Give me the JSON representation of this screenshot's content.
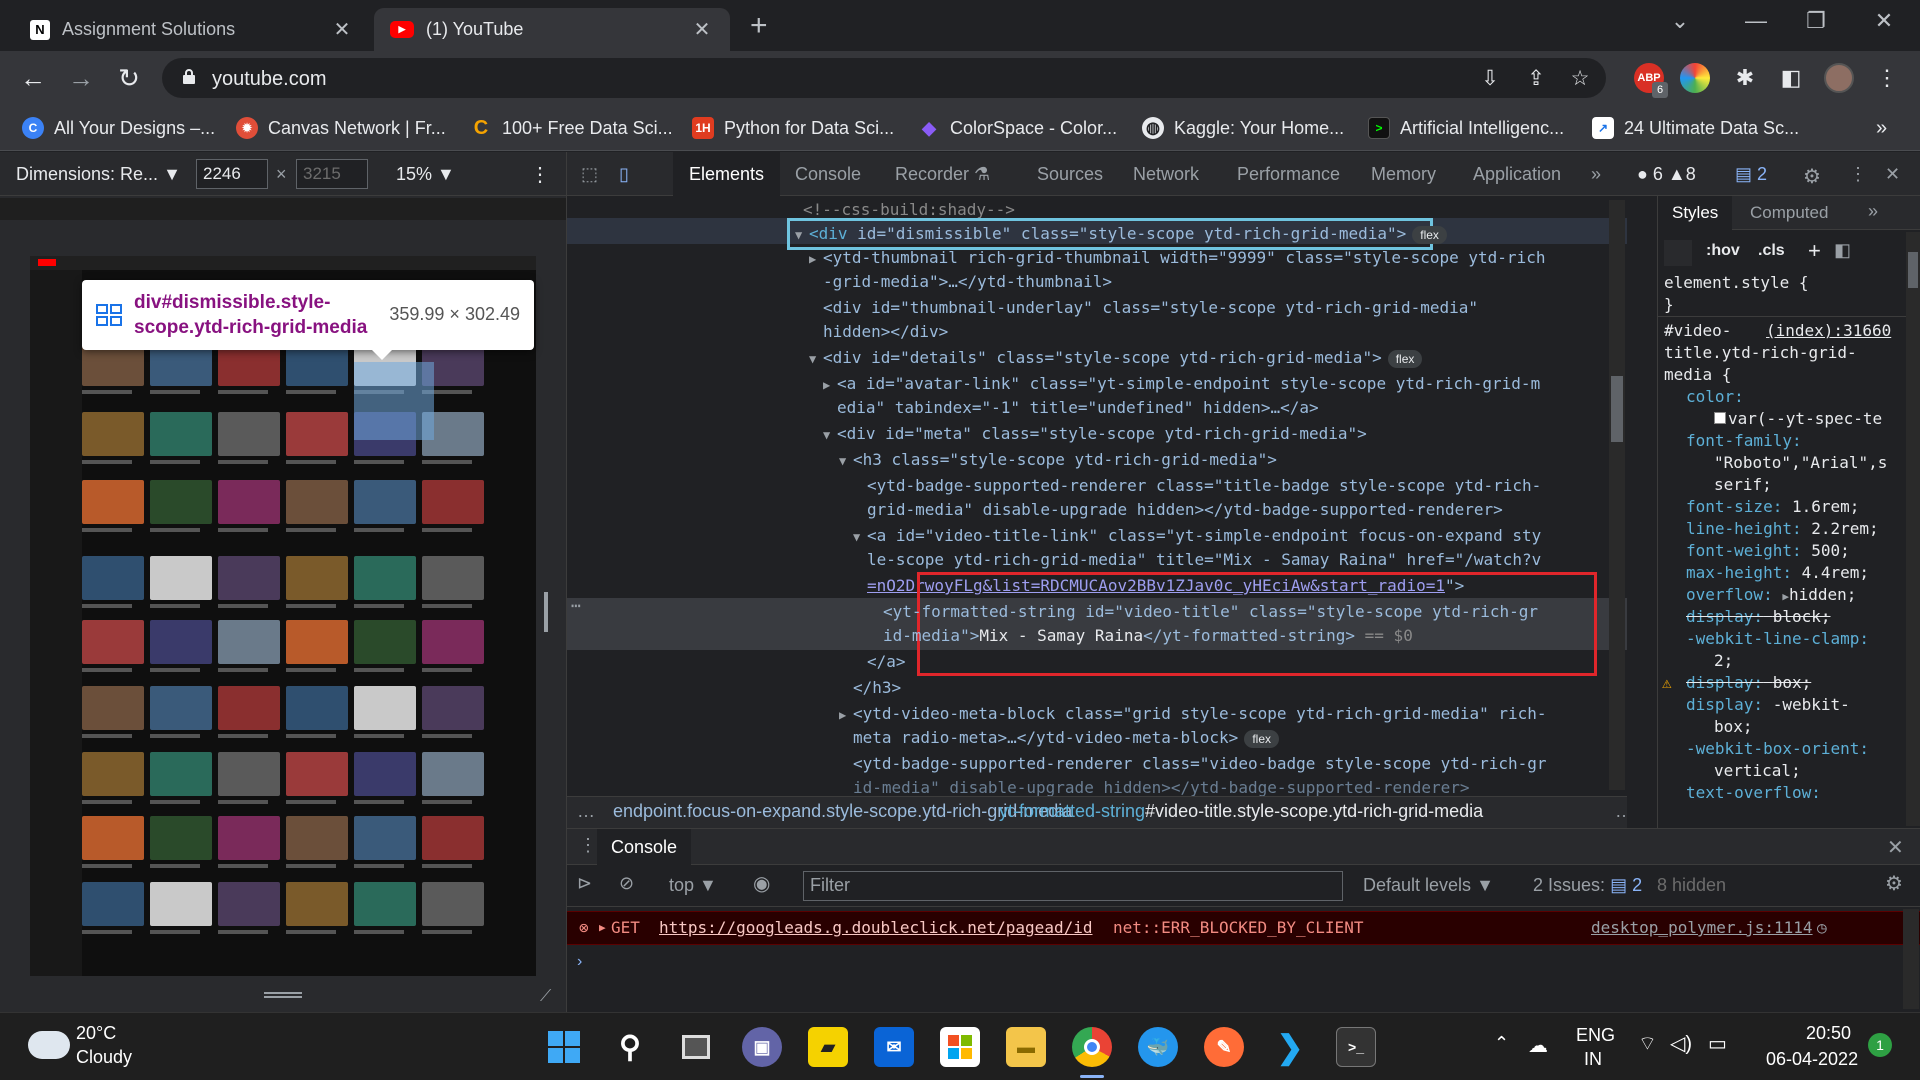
{
  "browser": {
    "tabs": [
      {
        "title": "Assignment Solutions",
        "favicon": "N"
      },
      {
        "title": "(1) YouTube",
        "favicon": "▶"
      }
    ],
    "url": "youtube.com",
    "ext_badge": "6",
    "bookmarks": [
      {
        "label": "All Your Designs –...",
        "color": "#3b82f6",
        "glyph": "C"
      },
      {
        "label": "Canvas Network | Fr...",
        "color": "#e04e39",
        "glyph": "✹"
      },
      {
        "label": "100+ Free Data Sci...",
        "color": "#f5a300",
        "glyph": "C"
      },
      {
        "label": "Python for Data Sci...",
        "color": "#e03c20",
        "glyph": "1H"
      },
      {
        "label": "ColorSpace - Color...",
        "color": "#8a5cf6",
        "glyph": "◆"
      },
      {
        "label": "Kaggle: Your Home...",
        "color": "#555555",
        "glyph": "◍"
      },
      {
        "label": "Artificial Intelligenc...",
        "color": "#111111",
        "glyph": ">"
      },
      {
        "label": "24 Ultimate Data Sc...",
        "color": "#ffffff",
        "glyph": "↗"
      }
    ]
  },
  "device_toolbar": {
    "dimensions_label": "Dimensions: Re...",
    "width": "2246",
    "height_placeholder": "3215",
    "zoom": "15%"
  },
  "tooltip": {
    "selector": "div#dismissible.style-scope.ytd-rich-grid-media",
    "size": "359.99 × 302.49"
  },
  "devtools": {
    "tabs": [
      "Elements",
      "Console",
      "Recorder",
      "Sources",
      "Network",
      "Performance",
      "Memory",
      "Application"
    ],
    "counts": {
      "errors": "6",
      "warnings": "8",
      "messages": "2"
    },
    "styles_tabs": [
      "Styles",
      "Computed"
    ],
    "styles_toolbar": {
      "hov": ":hov",
      "cls": ".cls"
    },
    "breadcrumbs": [
      "endpoint.focus-on-expand.style-scope.ytd-rich-grid-media",
      "yt-formatted-string",
      "#video-title.style-scope.ytd-rich-grid-media"
    ],
    "dom": {
      "l0": "<!--css-build:shady-->",
      "l1_tag": "<div ",
      "l1_attrs": "id=\"dismissible\" class=\"style-scope ytd-rich-grid-media\">",
      "l2": "<ytd-thumbnail rich-grid-thumbnail width=\"9999\" class=\"style-scope ytd-rich",
      "l3": "-grid-media\">…</ytd-thumbnail>",
      "l4": "<div id=\"thumbnail-underlay\" class=\"style-scope ytd-rich-grid-media\"",
      "l5": "hidden></div>",
      "l6": "<div id=\"details\" class=\"style-scope ytd-rich-grid-media\">",
      "l7": "<a id=\"avatar-link\" class=\"yt-simple-endpoint style-scope ytd-rich-grid-m",
      "l8": "edia\" tabindex=\"-1\" title=\"undefined\" hidden>…</a>",
      "l9": "<div id=\"meta\" class=\"style-scope ytd-rich-grid-media\">",
      "l10": "<h3 class=\"style-scope ytd-rich-grid-media\">",
      "l11": "<ytd-badge-supported-renderer class=\"title-badge style-scope ytd-rich-",
      "l12": "grid-media\" disable-upgrade hidden></ytd-badge-supported-renderer>",
      "l13": "<a id=\"video-title-link\" class=\"yt-simple-endpoint focus-on-expand sty",
      "l14": "le-scope ytd-rich-grid-media\" title=\"Mix - Samay Raina\" href=\"/watch?v",
      "l15": "=nO2DrwoyFLg&list=RDCMUCAov2BBv1ZJav0c_yHEciAw&start_radio=1",
      "l16a": "<yt-formatted-string id=\"video-title\" class=\"style-scope ytd-rich-gr",
      "l16b": "id-media\">",
      "l16text": "Mix - Samay Raina",
      "l16c": "</yt-formatted-string>",
      "l16d": "== $0",
      "l17": "</a>",
      "l18": "</h3>",
      "l19": "<ytd-video-meta-block class=\"grid style-scope ytd-rich-grid-media\" rich-",
      "l20": "meta radio-meta>…</ytd-video-meta-block>",
      "l21": "<ytd-badge-supported-renderer class=\"video-badge style-scope ytd-rich-gr",
      "l22": "id-media\" disable-upgrade hidden></ytd-badge-supported-renderer>",
      "flex": "flex"
    },
    "styles": {
      "element_style": "element.style {",
      "close": "}",
      "rule_sel1": "#video-",
      "rule_src": "(index):31660",
      "rule_sel2": "title.ytd-rich-grid-",
      "rule_sel3": "media {",
      "p1": "color:",
      "v1": "var(--yt-spec-te",
      "p2": "font-family:",
      "v2a": "\"Roboto\",\"Arial\",s",
      "v2b": "serif;",
      "p3": "font-size:",
      "v3": "1.6rem;",
      "p4": "line-height:",
      "v4": "2.2rem;",
      "p5": "font-weight:",
      "v5": "500;",
      "p6": "max-height:",
      "v6": "4.4rem;",
      "p7": "overflow:",
      "v7": "hidden;",
      "p8": "display:",
      "v8": "block;",
      "p9": "-webkit-line-clamp:",
      "v9": "2;",
      "p10": "display:",
      "v10": "box;",
      "p11": "display:",
      "v11a": "-webkit-",
      "v11b": "box;",
      "p12": "-webkit-box-orient:",
      "v12": "vertical;",
      "p13": "text-overflow:"
    },
    "console": {
      "drawer_title": "Console",
      "context": "top",
      "filter_placeholder": "Filter",
      "levels": "Default levels",
      "issues_label": "2 Issues:",
      "issues_count": "2",
      "hidden": "8 hidden",
      "error_method": "GET",
      "error_url": "https://googleads.g.doubleclick.net/pagead/id",
      "error_msg": "net::ERR_BLOCKED_BY_CLIENT",
      "error_src": "desktop_polymer.js:1114"
    }
  },
  "taskbar": {
    "weather_temp": "20°C",
    "weather_desc": "Cloudy",
    "lang1": "ENG",
    "lang2": "IN",
    "time": "20:50",
    "date": "06-04-2022",
    "notif_count": "1"
  }
}
